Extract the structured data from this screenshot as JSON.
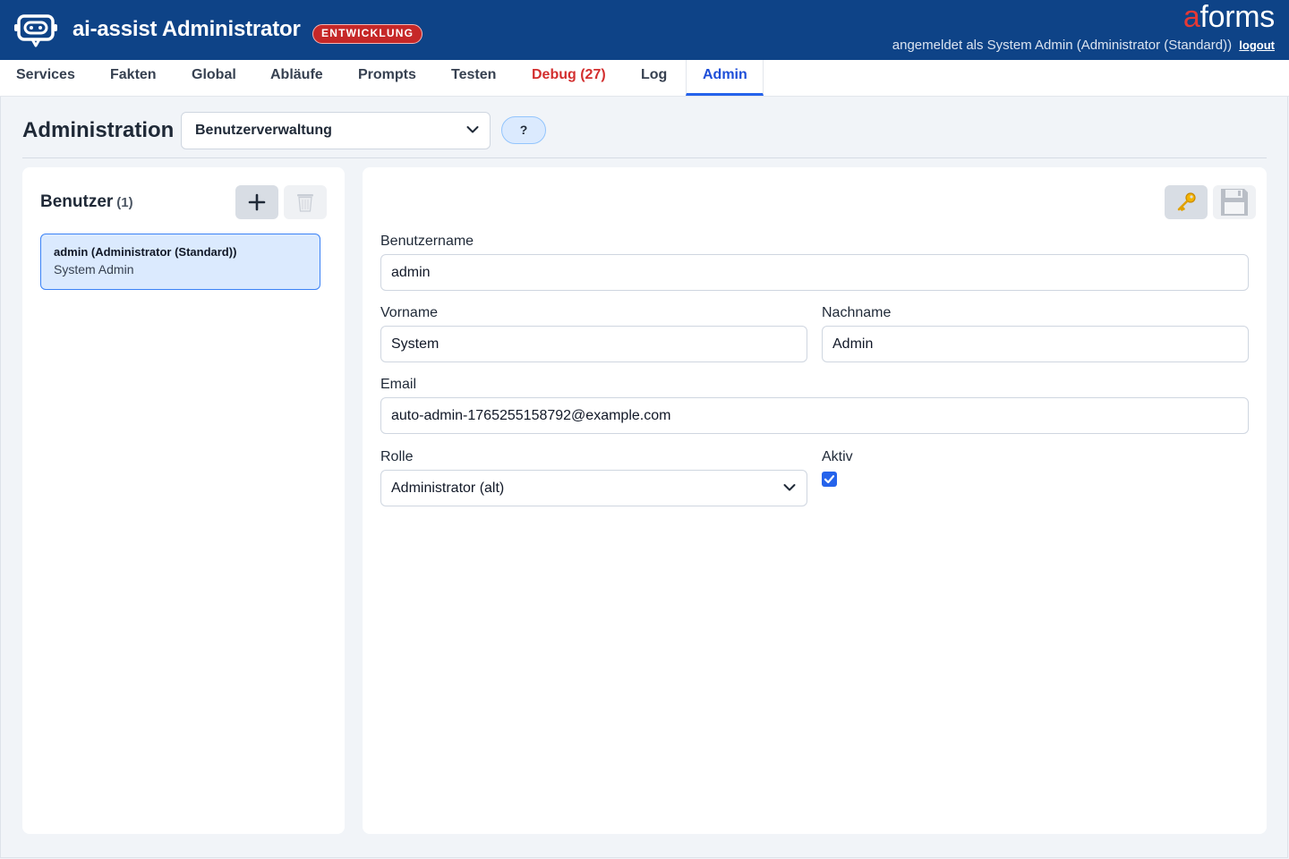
{
  "header": {
    "app_title": "ai-assist Administrator",
    "env_badge": "ENTWICKLUNG",
    "brand_accent": "a",
    "brand_rest": "forms",
    "login_text": "angemeldet als System Admin (Administrator (Standard))",
    "logout": "logout"
  },
  "nav": {
    "tabs": [
      {
        "label": "Services"
      },
      {
        "label": "Fakten"
      },
      {
        "label": "Global"
      },
      {
        "label": "Abläufe"
      },
      {
        "label": "Prompts"
      },
      {
        "label": "Testen"
      },
      {
        "label": "Debug (27)"
      },
      {
        "label": "Log"
      },
      {
        "label": "Admin",
        "active": true
      }
    ]
  },
  "admin": {
    "title": "Administration",
    "section_select": "Benutzerverwaltung",
    "help_label": "?"
  },
  "users": {
    "title": "Benutzer",
    "count": "(1)",
    "items": [
      {
        "line1": "admin (Administrator (Standard))",
        "line2": "System Admin"
      }
    ]
  },
  "form": {
    "username_label": "Benutzername",
    "username": "admin",
    "firstname_label": "Vorname",
    "firstname": "System",
    "lastname_label": "Nachname",
    "lastname": "Admin",
    "email_label": "Email",
    "email": "auto-admin-1765255158792@example.com",
    "role_label": "Rolle",
    "role": "Administrator (alt)",
    "active_label": "Aktiv",
    "active": true
  },
  "colors": {
    "header_bg": "#0e4387",
    "accent": "#2563eb",
    "debug": "#d32f2f",
    "badge": "#c62828"
  },
  "icons": [
    "robot-logo-icon",
    "plus-icon",
    "trash-icon",
    "key-icon",
    "floppy-save-icon",
    "chevron-down-icon",
    "checkmark-icon"
  ]
}
